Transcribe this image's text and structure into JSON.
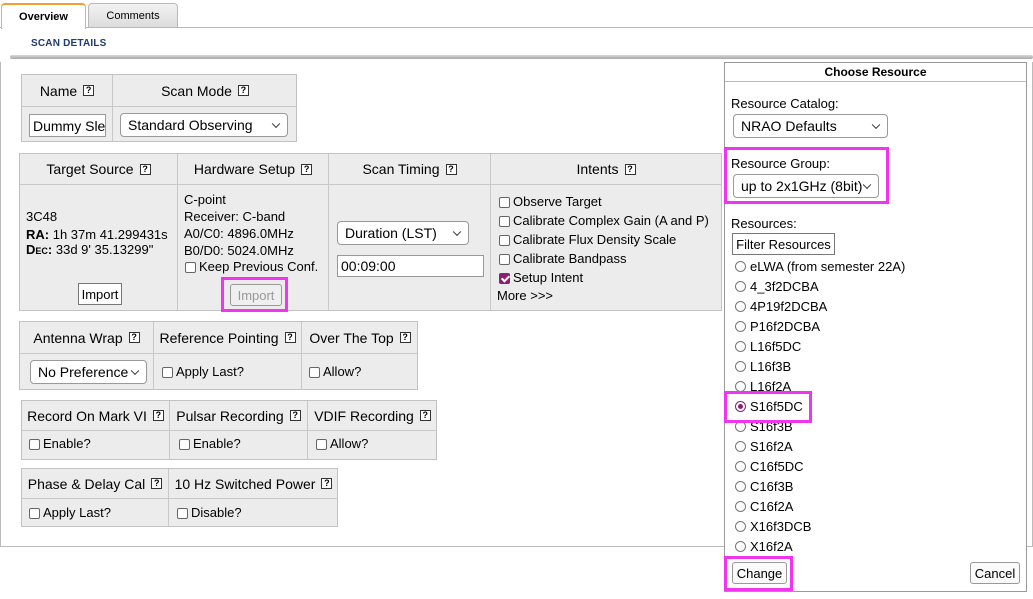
{
  "tabs": [
    {
      "label": "Overview"
    },
    {
      "label": "Comments"
    }
  ],
  "section_title": "SCAN DETAILS",
  "help_glyph": "?",
  "name_group": {
    "name_header": "Name",
    "mode_header": "Scan Mode",
    "name_value": "Dummy Slew",
    "mode_value": "Standard Observing"
  },
  "main_group": {
    "target_header": "Target Source",
    "hardware_header": "Hardware Setup",
    "timing_header": "Scan Timing",
    "intents_header": "Intents",
    "source_name": "3C48",
    "ra_label": "RA:",
    "ra_value": "1h 37m 41.299431s",
    "dec_label": "Dec:",
    "dec_value": "33d 9' 35.13299\"",
    "import_label": "Import",
    "hw_name": "C-point",
    "hw_receiver": "Receiver: C-band",
    "hw_a0c0": "A0/C0: 4896.0MHz",
    "hw_b0d0": "B0/D0: 5024.0MHz",
    "keep_prev": "Keep Previous Conf.",
    "hw_import_label": "Import",
    "timing_mode": "Duration (LST)",
    "timing_value": "00:09:00",
    "intents": [
      {
        "label": "Observe Target",
        "checked": false
      },
      {
        "label": "Calibrate Complex Gain (A and P)",
        "checked": false
      },
      {
        "label": "Calibrate Flux Density Scale",
        "checked": false
      },
      {
        "label": "Calibrate Bandpass",
        "checked": false
      },
      {
        "label": "Setup Intent",
        "checked": true
      }
    ],
    "more": "More >>>"
  },
  "antenna_group": {
    "wrap_header": "Antenna Wrap",
    "refpoint_header": "Reference Pointing",
    "overtop_header": "Over The Top",
    "wrap_value": "No Preference",
    "apply_last": "Apply Last?",
    "allow": "Allow?"
  },
  "record_group": {
    "mark_header": "Record On Mark VI",
    "pulsar_header": "Pulsar Recording",
    "vdif_header": "VDIF Recording",
    "enable1": "Enable?",
    "enable2": "Enable?",
    "allow": "Allow?"
  },
  "phase_group": {
    "phase_header": "Phase & Delay Cal",
    "switched_header": "10 Hz Switched Power",
    "apply_last": "Apply Last?",
    "disable": "Disable?"
  },
  "dialog": {
    "title": "Choose Resource",
    "catalog_label": "Resource Catalog:",
    "catalog_value": "NRAO Defaults",
    "group_label": "Resource Group:",
    "group_value": "up to 2x1GHz (8bit)",
    "resources_label": "Resources:",
    "filter_label": "Filter Resources",
    "resources": [
      {
        "label": "eLWA (from semester 22A)",
        "selected": false
      },
      {
        "label": "4_3f2DCBA",
        "selected": false
      },
      {
        "label": "4P19f2DCBA",
        "selected": false
      },
      {
        "label": "P16f2DCBA",
        "selected": false
      },
      {
        "label": "L16f5DC",
        "selected": false
      },
      {
        "label": "L16f3B",
        "selected": false
      },
      {
        "label": "L16f2A",
        "selected": false
      },
      {
        "label": "S16f5DC",
        "selected": true
      },
      {
        "label": "S16f3B",
        "selected": false
      },
      {
        "label": "S16f2A",
        "selected": false
      },
      {
        "label": "C16f5DC",
        "selected": false
      },
      {
        "label": "C16f3B",
        "selected": false
      },
      {
        "label": "C16f2A",
        "selected": false
      },
      {
        "label": "X16f3DCB",
        "selected": false
      },
      {
        "label": "X16f2A",
        "selected": false
      }
    ],
    "change_label": "Change",
    "cancel_label": "Cancel"
  },
  "colors": {
    "highlight": "#f034f0",
    "accent": "#8a1f70",
    "section_title": "#1e3c6c"
  }
}
